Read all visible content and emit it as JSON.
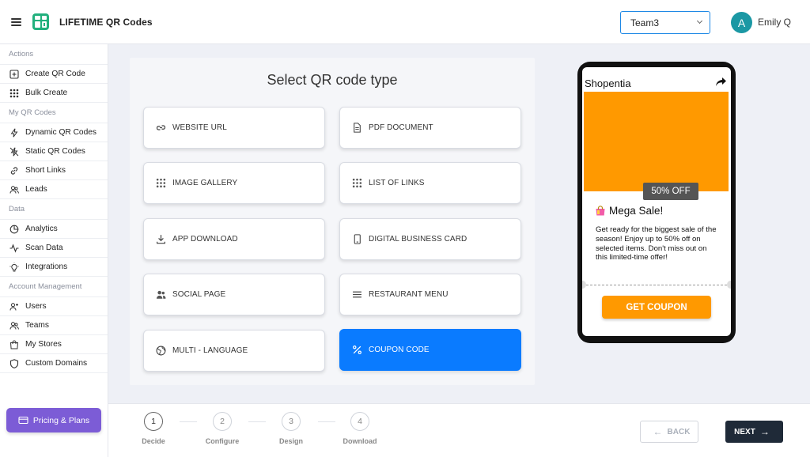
{
  "header": {
    "app_title": "LIFETIME QR Codes",
    "team_selected": "Team3",
    "avatar_initial": "A",
    "user_name": "Emily Q"
  },
  "sidebar": {
    "sections": [
      {
        "title": "Actions",
        "items": [
          {
            "label": "Create QR Code",
            "icon": "plus-square-icon"
          },
          {
            "label": "Bulk Create",
            "icon": "grid-icon"
          }
        ]
      },
      {
        "title": "My QR Codes",
        "items": [
          {
            "label": "Dynamic QR Codes",
            "icon": "lightning-icon"
          },
          {
            "label": "Static QR Codes",
            "icon": "lightning-off-icon"
          },
          {
            "label": "Short Links",
            "icon": "link-icon"
          },
          {
            "label": "Leads",
            "icon": "users-icon"
          }
        ]
      },
      {
        "title": "Data",
        "items": [
          {
            "label": "Analytics",
            "icon": "pie-chart-icon"
          },
          {
            "label": "Scan Data",
            "icon": "activity-icon"
          },
          {
            "label": "Integrations",
            "icon": "bulb-icon"
          }
        ]
      },
      {
        "title": "Account Management",
        "items": [
          {
            "label": "Users",
            "icon": "user-plus-icon"
          },
          {
            "label": "Teams",
            "icon": "users-icon"
          },
          {
            "label": "My Stores",
            "icon": "store-icon"
          },
          {
            "label": "Custom Domains",
            "icon": "shield-icon"
          }
        ]
      }
    ],
    "pricing_label": "Pricing & Plans"
  },
  "main": {
    "title": "Select QR code type",
    "types": [
      {
        "label": "WEBSITE URL",
        "icon": "link-icon",
        "selected": false
      },
      {
        "label": "PDF DOCUMENT",
        "icon": "document-icon",
        "selected": false
      },
      {
        "label": "IMAGE GALLERY",
        "icon": "grid-icon",
        "selected": false
      },
      {
        "label": "LIST OF LINKS",
        "icon": "grid-icon",
        "selected": false
      },
      {
        "label": "APP DOWNLOAD",
        "icon": "download-icon",
        "selected": false
      },
      {
        "label": "DIGITAL BUSINESS CARD",
        "icon": "phone-icon",
        "selected": false
      },
      {
        "label": "SOCIAL PAGE",
        "icon": "users-icon",
        "selected": false
      },
      {
        "label": "RESTAURANT MENU",
        "icon": "menu-lines-icon",
        "selected": false
      },
      {
        "label": "MULTI - LANGUAGE",
        "icon": "globe-icon",
        "selected": false
      },
      {
        "label": "COUPON CODE",
        "icon": "percent-icon",
        "selected": true
      }
    ]
  },
  "preview": {
    "shop_name": "Shopentia",
    "badge": "50% OFF",
    "sale_title": "Mega Sale!",
    "sale_text": "Get ready for the biggest sale of the season! Enjoy up to 50% off on selected items. Don't miss out on this limited-time offer!",
    "coupon_button": "GET COUPON",
    "banner_color": "#ff9900"
  },
  "footer": {
    "steps": [
      {
        "number": "1",
        "label": "Decide",
        "active": true
      },
      {
        "number": "2",
        "label": "Configure",
        "active": false
      },
      {
        "number": "3",
        "label": "Design",
        "active": false
      },
      {
        "number": "4",
        "label": "Download",
        "active": false
      }
    ],
    "back_label": "BACK",
    "next_label": "NEXT"
  },
  "colors": {
    "accent": "#0a7bff",
    "pricing": "#7c5cd6",
    "logo": "#22b07d",
    "avatar": "#1b98a4",
    "next_button": "#1f2a38"
  }
}
